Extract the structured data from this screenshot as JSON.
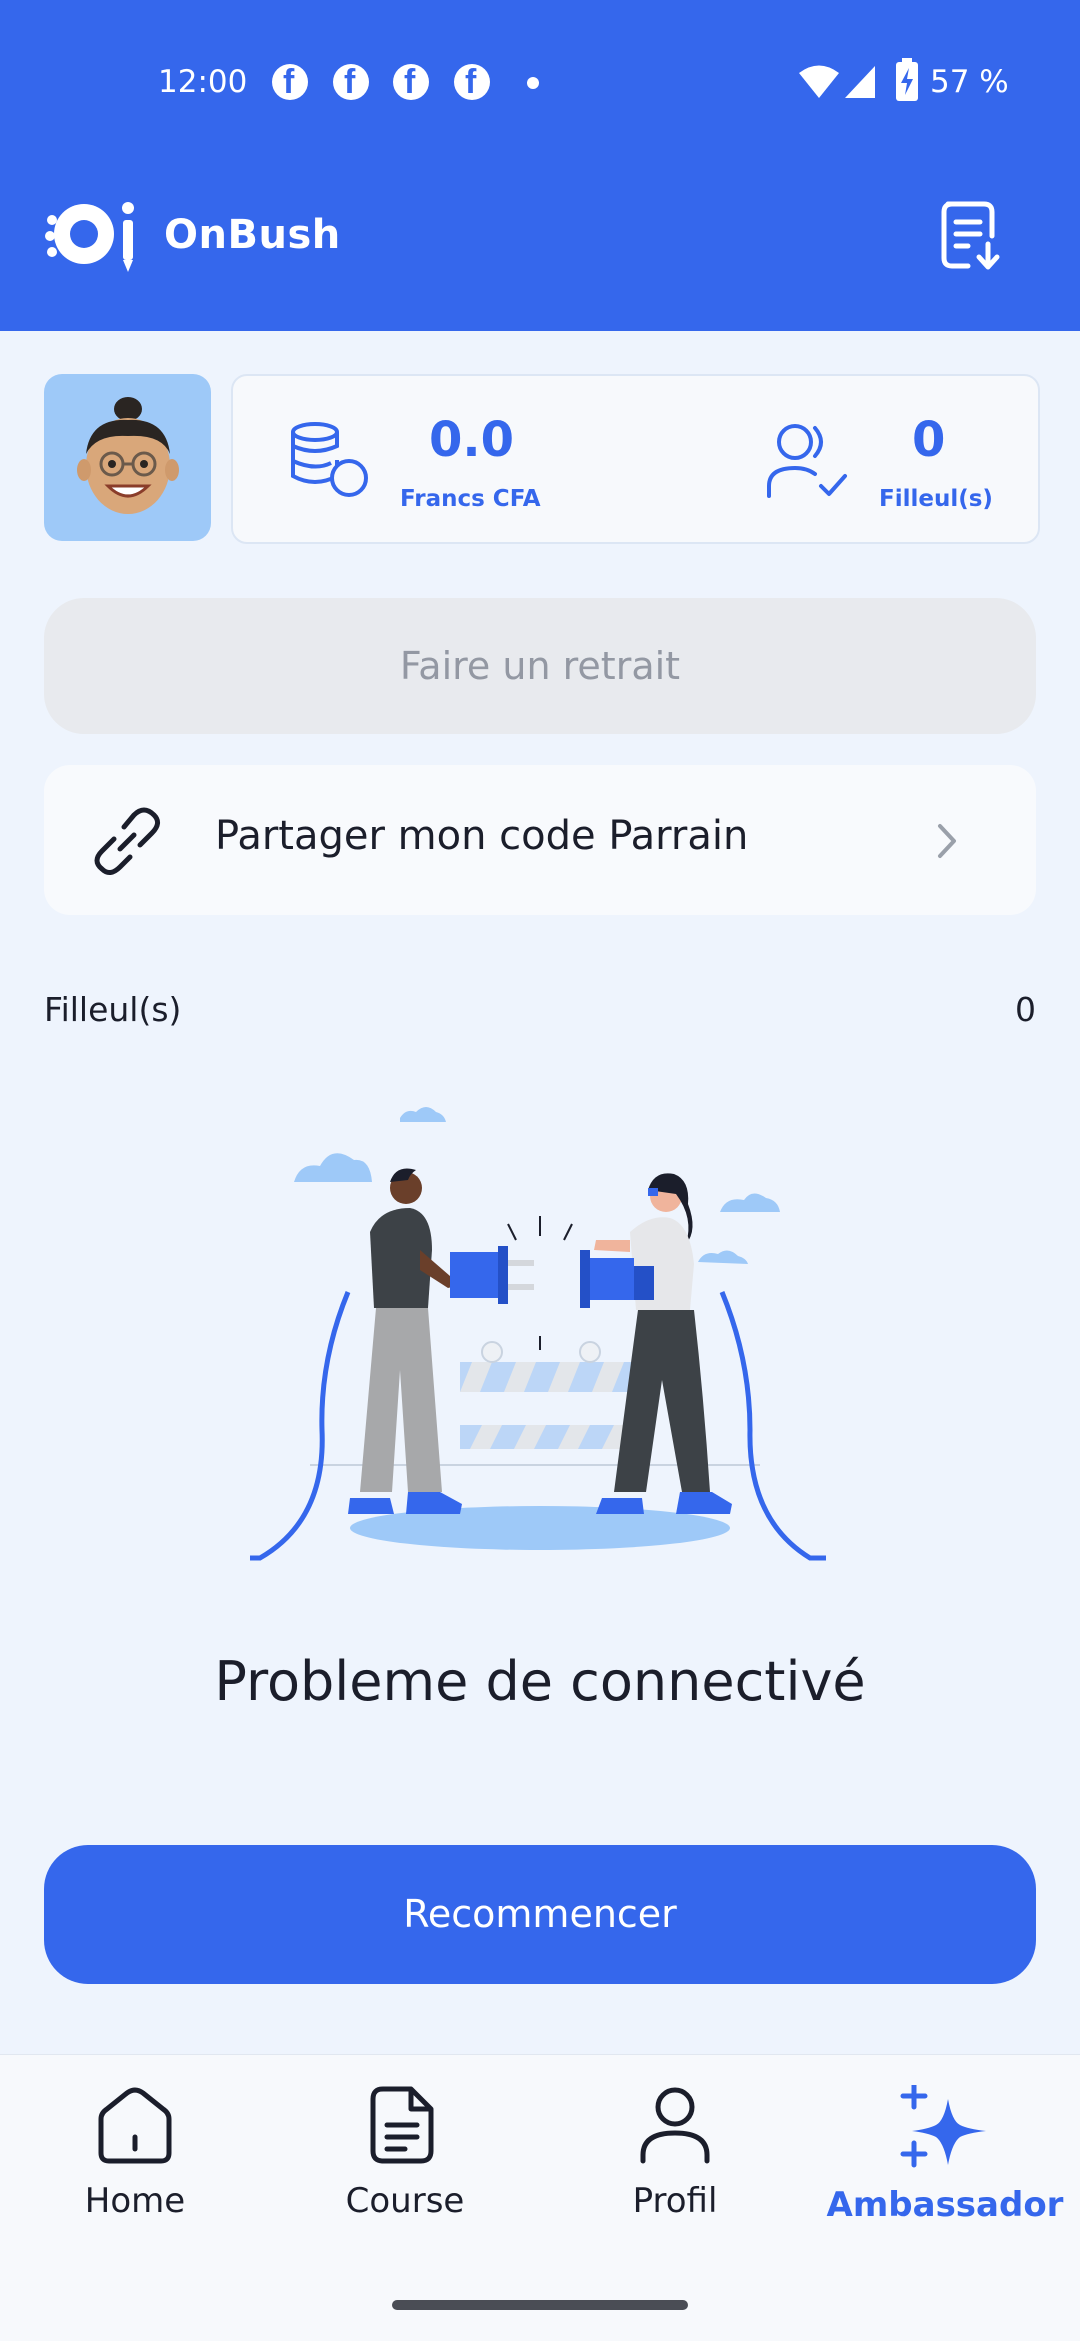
{
  "status_bar": {
    "time": "12:00",
    "battery": "57 %"
  },
  "app": {
    "name": "OnBush"
  },
  "stats": {
    "balance_value": "0.0",
    "balance_unit": "Francs CFA",
    "referrals_value": "0",
    "referrals_label": "Filleul(s)"
  },
  "actions": {
    "withdraw_label": "Faire un retrait",
    "share_label": "Partager mon code Parrain"
  },
  "referrals_section": {
    "title": "Filleul(s)",
    "count": "0"
  },
  "error": {
    "message": "Probleme de connectivé",
    "retry_label": "Recommencer"
  },
  "nav": {
    "items": [
      {
        "label": "Home",
        "icon": "home-icon"
      },
      {
        "label": "Course",
        "icon": "document-icon"
      },
      {
        "label": "Profil",
        "icon": "person-icon"
      },
      {
        "label": "Ambassador",
        "icon": "sparkle-icon",
        "active": true
      }
    ]
  },
  "colors": {
    "primary": "#3567ec",
    "background": "#eef4fd",
    "text": "#1b1e2b"
  }
}
